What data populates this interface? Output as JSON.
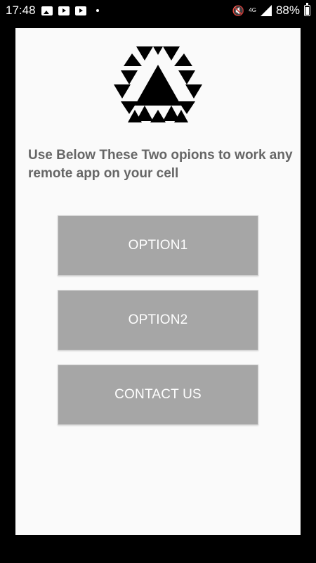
{
  "status_bar": {
    "time": "17:48",
    "network": "4G",
    "battery_percent": "88%",
    "icons": [
      "photo-icon",
      "youtube-icon",
      "youtube-icon",
      "dot-icon",
      "mute-icon",
      "signal-icon",
      "battery-icon"
    ]
  },
  "main": {
    "logo": "triangle-hexagon-logo",
    "heading": "Use Below These Two opions to work any remote app on your cell",
    "buttons": {
      "option1": "OPTION1",
      "option2": "OPTION2",
      "contact": "CONTACT US"
    }
  },
  "colors": {
    "button_bg": "#a6a6a6",
    "heading_text": "#666666",
    "card_bg": "#fafafa"
  }
}
